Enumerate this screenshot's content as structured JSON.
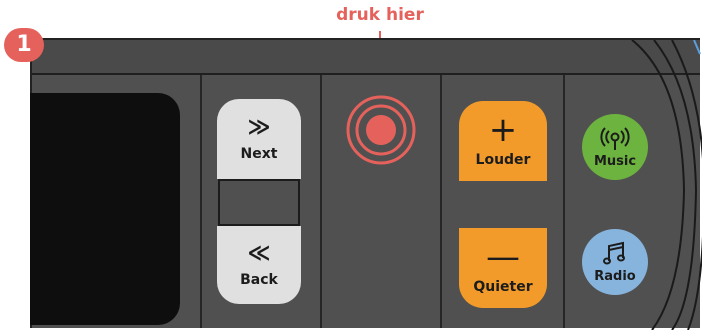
{
  "callout": {
    "label": "druk hier",
    "step": "1",
    "color": "#e5625c"
  },
  "device": {
    "body_color": "#505050",
    "screen_color": "#0e0e0e"
  },
  "buttons": {
    "next": {
      "icon": "fast-forward-icon",
      "glyph": "≫",
      "label": "Next"
    },
    "back": {
      "icon": "rewind-icon",
      "glyph": "≪",
      "label": "Back"
    },
    "louder": {
      "icon": "plus-icon",
      "glyph": "+",
      "label": "Louder",
      "color": "#f29b2a"
    },
    "quieter": {
      "icon": "minus-icon",
      "glyph": "—",
      "label": "Quieter",
      "color": "#f29b2a"
    },
    "music": {
      "icon": "broadcast-icon",
      "label": "Music",
      "color": "#6db33f"
    },
    "radio": {
      "icon": "music-note-icon",
      "label": "Radio",
      "color": "#87b4dc"
    }
  }
}
